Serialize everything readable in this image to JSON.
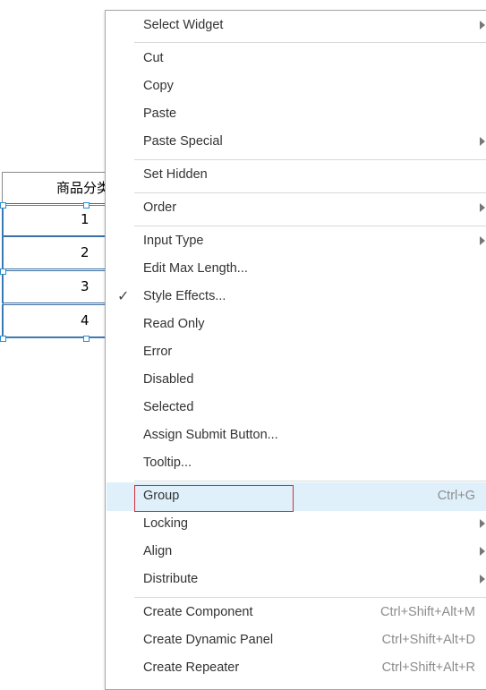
{
  "table": {
    "header": "商品分类",
    "rows": [
      "1",
      "2",
      "3",
      "4"
    ]
  },
  "menu": {
    "select_widget": "Select Widget",
    "cut": "Cut",
    "copy": "Copy",
    "paste": "Paste",
    "paste_special": "Paste Special",
    "set_hidden": "Set Hidden",
    "order": "Order",
    "input_type": "Input Type",
    "edit_max_length": "Edit Max Length...",
    "style_effects": "Style Effects...",
    "read_only": "Read Only",
    "error": "Error",
    "disabled": "Disabled",
    "selected": "Selected",
    "assign_submit": "Assign Submit Button...",
    "tooltip": "Tooltip...",
    "group": "Group",
    "group_shortcut": "Ctrl+G",
    "locking": "Locking",
    "align": "Align",
    "distribute": "Distribute",
    "create_component": "Create Component",
    "create_component_shortcut": "Ctrl+Shift+Alt+M",
    "create_dynamic_panel": "Create Dynamic Panel",
    "create_dynamic_panel_shortcut": "Ctrl+Shift+Alt+D",
    "create_repeater": "Create Repeater",
    "create_repeater_shortcut": "Ctrl+Shift+Alt+R"
  },
  "icons": {
    "checkmark": "check-icon",
    "submenu": "chevron-right-icon"
  },
  "colors": {
    "highlight": "#dff0fb",
    "annotation_box": "#d0313a",
    "selection": "#2d8ccd"
  }
}
